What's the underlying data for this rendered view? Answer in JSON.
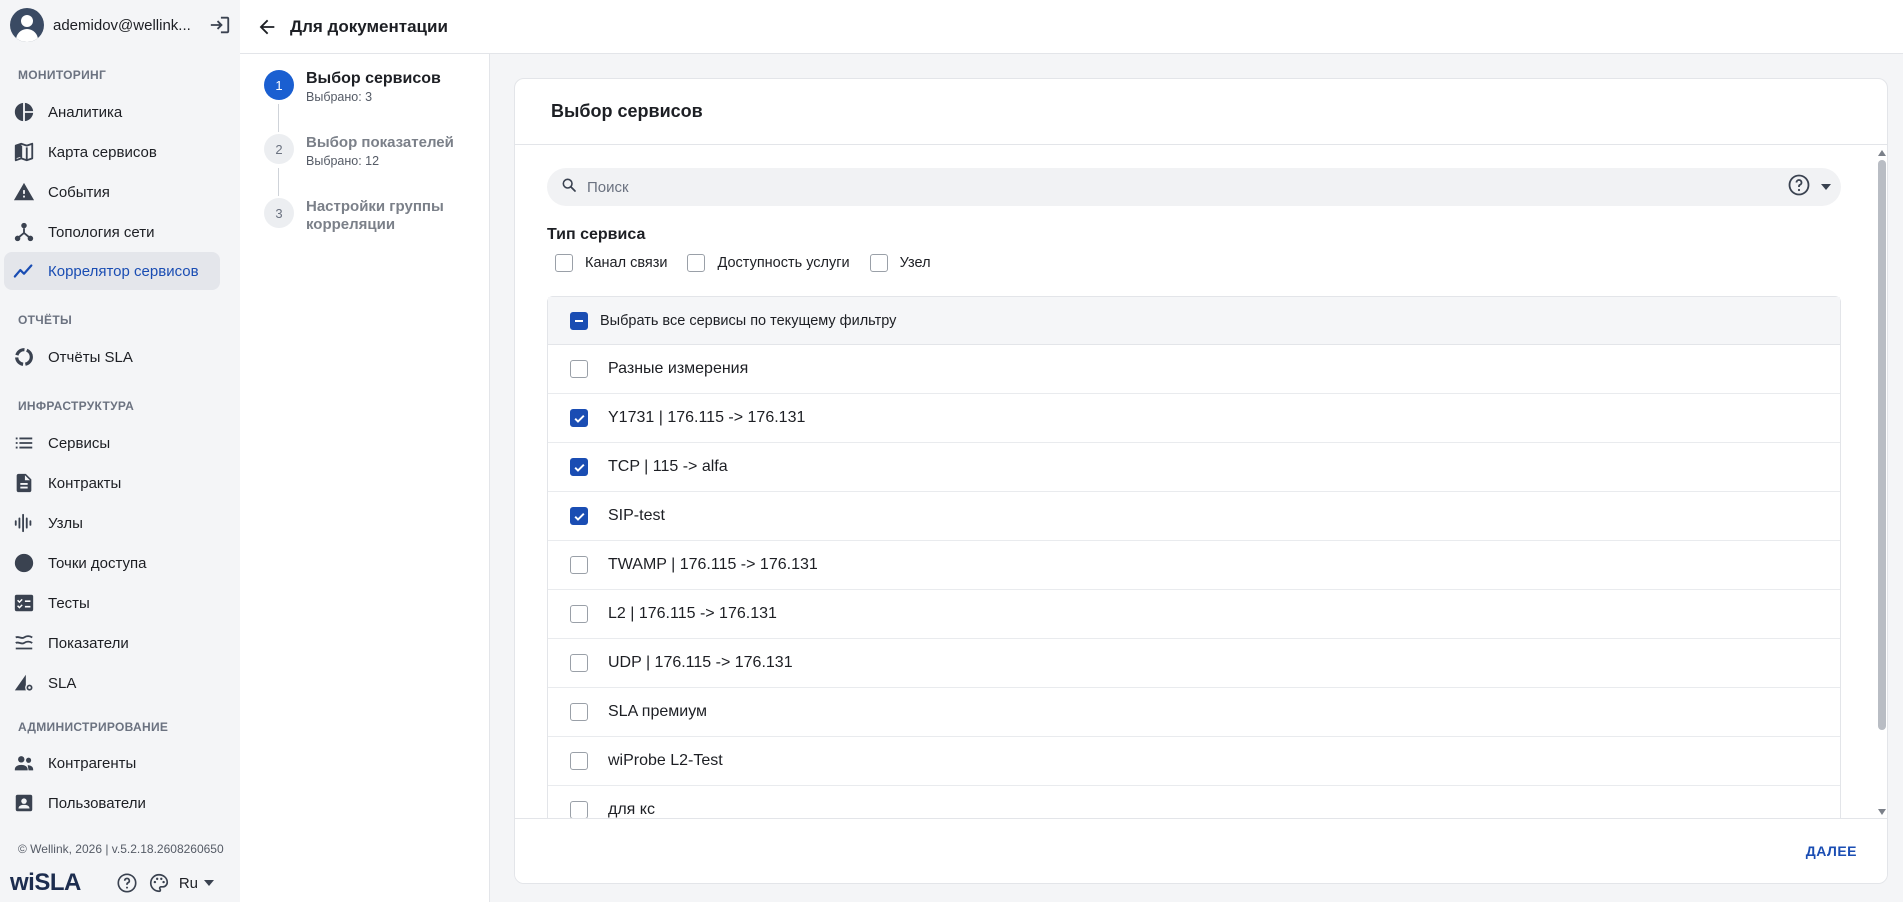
{
  "user": {
    "name": "ademidov@wellink..."
  },
  "sidebar": {
    "sections": [
      {
        "title": "МОНИТОРИНГ"
      },
      {
        "title": "ОТЧЁТЫ"
      },
      {
        "title": "ИНФРАСТРУКТУРА"
      },
      {
        "title": "АДМИНИСТРИРОВАНИЕ"
      }
    ],
    "items": [
      {
        "label": "Аналитика",
        "icon": "pie-chart-icon"
      },
      {
        "label": "Карта сервисов",
        "icon": "map-icon"
      },
      {
        "label": "События",
        "icon": "warning-icon"
      },
      {
        "label": "Топология сети",
        "icon": "topology-icon"
      },
      {
        "label": "Коррелятор сервисов",
        "icon": "trend-icon",
        "active": true
      },
      {
        "label": "Отчёты SLA",
        "icon": "report-ring-icon"
      },
      {
        "label": "Сервисы",
        "icon": "list-icon"
      },
      {
        "label": "Контракты",
        "icon": "document-icon"
      },
      {
        "label": "Узлы",
        "icon": "nodes-icon"
      },
      {
        "label": "Точки доступа",
        "icon": "circle-icon"
      },
      {
        "label": "Тесты",
        "icon": "checklist-icon"
      },
      {
        "label": "Показатели",
        "icon": "metrics-icon"
      },
      {
        "label": "SLA",
        "icon": "sla-gear-icon"
      },
      {
        "label": "Контрагенты",
        "icon": "people-icon"
      },
      {
        "label": "Пользователи",
        "icon": "user-card-icon"
      }
    ],
    "version": "© Wellink, 2026 | v.5.2.18.2608260650",
    "logo": "wiSLA",
    "language": "Ru"
  },
  "header": {
    "title": "Для документации"
  },
  "stepper": {
    "steps": [
      {
        "number": "1",
        "title": "Выбор сервисов",
        "subtitle": "Выбрано: 3",
        "active": true
      },
      {
        "number": "2",
        "title": "Выбор показателей",
        "subtitle": "Выбрано: 12",
        "active": false
      },
      {
        "number": "3",
        "title": "Настройки группы корреляции",
        "subtitle": "",
        "active": false
      }
    ]
  },
  "main": {
    "title": "Выбор сервисов",
    "search": {
      "placeholder": "Поиск",
      "value": ""
    },
    "filter": {
      "title": "Тип сервиса",
      "options": [
        {
          "label": "Канал связи",
          "checked": false
        },
        {
          "label": "Доступность услуги",
          "checked": false
        },
        {
          "label": "Узел",
          "checked": false
        }
      ]
    },
    "select_all_label": "Выбрать все сервисы по текущему фильтру",
    "services": [
      {
        "label": "Разные измерения",
        "checked": false
      },
      {
        "label": "Y1731 | 176.115 -> 176.131",
        "checked": true
      },
      {
        "label": "TCP | 115 -> alfa",
        "checked": true
      },
      {
        "label": "SIP-test",
        "checked": true
      },
      {
        "label": "TWAMP | 176.115 -> 176.131",
        "checked": false
      },
      {
        "label": "L2 | 176.115 -> 176.131",
        "checked": false
      },
      {
        "label": "UDP | 176.115 -> 176.131",
        "checked": false
      },
      {
        "label": "SLA премиум",
        "checked": false
      },
      {
        "label": "wiProbe L2-Test",
        "checked": false
      },
      {
        "label": "для кс",
        "checked": false
      }
    ],
    "next_label": "ДАЛЕЕ"
  },
  "colors": {
    "accent": "#1a4db3",
    "step_active": "#1a5fd1",
    "sidebar_bg": "#f4f5f7"
  }
}
